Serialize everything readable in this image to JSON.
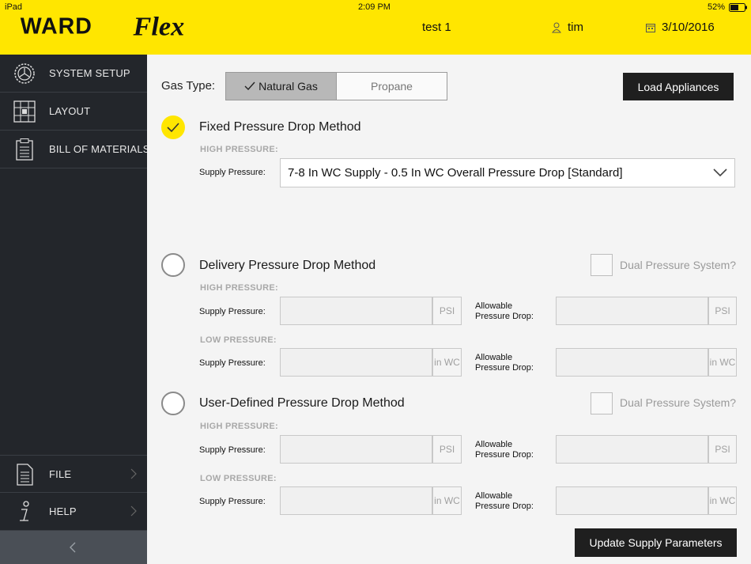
{
  "status_bar": {
    "device": "iPad",
    "time": "2:09 PM",
    "battery": "52%"
  },
  "header": {
    "logo_text": "WARDFlex",
    "project": "test 1",
    "user": "tim",
    "date": "3/10/2016",
    "brand_color": "#ffe600"
  },
  "sidebar": {
    "items": [
      {
        "label": "SYSTEM SETUP",
        "icon": "gear-icon"
      },
      {
        "label": "LAYOUT",
        "icon": "grid-layout-icon"
      },
      {
        "label": "BILL OF MATERIALS",
        "icon": "clipboard-icon"
      }
    ],
    "bottom_items": [
      {
        "label": "FILE",
        "icon": "document-icon"
      },
      {
        "label": "HELP",
        "icon": "info-icon"
      }
    ]
  },
  "main": {
    "gas_type_label": "Gas Type:",
    "gas_options": [
      {
        "label": "Natural Gas",
        "selected": true
      },
      {
        "label": "Propane",
        "selected": false
      }
    ],
    "load_appliances_label": "Load Appliances",
    "fixed": {
      "title": "Fixed Pressure Drop Method",
      "selected": true,
      "high_pressure_label": "HIGH PRESSURE:",
      "supply_pressure_label": "Supply Pressure:",
      "supply_value": "7-8 In WC Supply - 0.5 In WC Overall Pressure Drop [Standard]"
    },
    "delivery": {
      "title": "Delivery Pressure Drop Method",
      "dual_label": "Dual Pressure System?",
      "high_pressure_label": "HIGH PRESSURE:",
      "low_pressure_label": "LOW PRESSURE:",
      "supply_pressure_label": "Supply Pressure:",
      "allowable_line1": "Allowable",
      "allowable_line2": "Pressure Drop:",
      "unit_psi": "PSI",
      "unit_inwc": "in WC"
    },
    "user_defined": {
      "title": "User-Defined Pressure Drop Method",
      "dual_label": "Dual Pressure System?",
      "high_pressure_label": "HIGH PRESSURE:",
      "low_pressure_label": "LOW PRESSURE:",
      "supply_pressure_label": "Supply Pressure:",
      "allowable_line1": "Allowable",
      "allowable_line2": "Pressure Drop:",
      "unit_psi": "PSI",
      "unit_inwc": "in WC"
    },
    "update_button_label": "Update Supply Parameters"
  }
}
